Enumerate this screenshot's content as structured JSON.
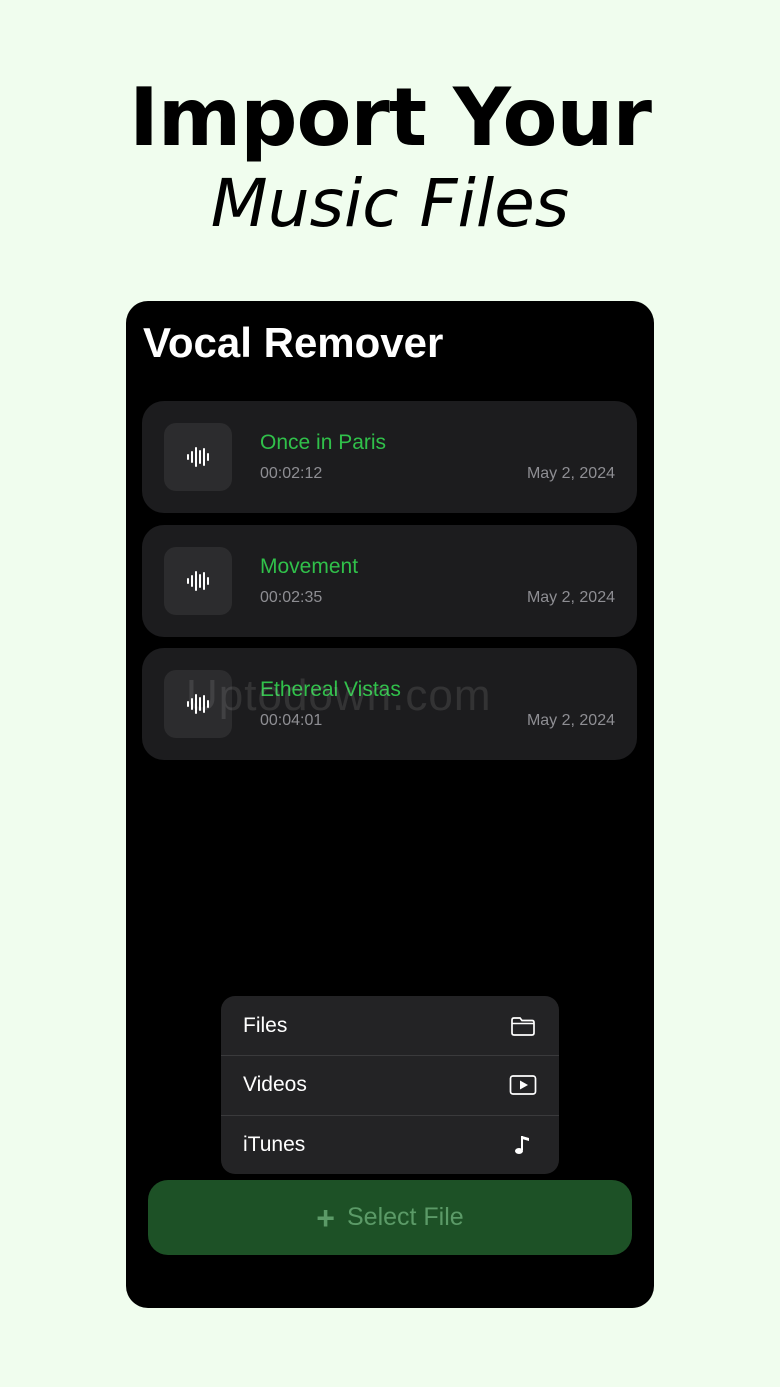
{
  "headline": {
    "line1": "Import Your",
    "line2": "Music Files"
  },
  "app": {
    "title": "Vocal Remover",
    "watermark": "Uptodown.com"
  },
  "tracks": [
    {
      "name": "Once in Paris",
      "duration": "00:02:12",
      "date": "May 2, 2024"
    },
    {
      "name": "Movement",
      "duration": "00:02:35",
      "date": "May 2, 2024"
    },
    {
      "name": "Ethereal Vistas",
      "duration": "00:04:01",
      "date": "May 2, 2024"
    }
  ],
  "menu": {
    "items": [
      {
        "label": "Files",
        "icon": "folder-icon"
      },
      {
        "label": "Videos",
        "icon": "play-icon"
      },
      {
        "label": "iTunes",
        "icon": "music-note-icon"
      }
    ]
  },
  "select_button": {
    "label": "Select File",
    "icon": "plus-icon"
  },
  "colors": {
    "background": "#f0fdee",
    "accent_green": "#30c04a",
    "button_green": "#1d5126",
    "card": "#1c1c1e"
  }
}
